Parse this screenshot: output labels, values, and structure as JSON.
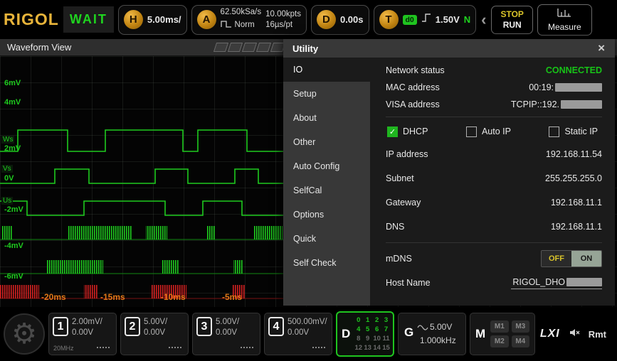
{
  "header": {
    "logo": "RIGOL",
    "run_state": "WAIT",
    "horizontal": {
      "knob": "H",
      "timebase": "5.00ms/"
    },
    "acquire": {
      "knob": "A",
      "sample_rate": "62.50kSa/s",
      "mode": "Norm",
      "mem_depth": "10.00kpts",
      "time_per_pt": "16µs/pt"
    },
    "delay": {
      "knob": "D",
      "value": "0.00s"
    },
    "trigger": {
      "knob": "T",
      "source": "d0",
      "level": "1.50V",
      "slope": "N"
    },
    "chevron_left": "‹",
    "stop_label": "STOP",
    "run_label": "RUN",
    "measure_label": "Measure"
  },
  "waveform_view": {
    "title": "Waveform View",
    "y_labels": [
      "6mV",
      "4mV",
      "2mV",
      "0V",
      "-2mV",
      "-4mV",
      "-6mV"
    ],
    "marker_labels": [
      "Ws",
      "Vs",
      "Us"
    ],
    "x_labels": [
      "-20ms",
      "-15ms",
      "-10ms",
      "-5ms"
    ]
  },
  "utility": {
    "title": "Utility",
    "close": "×",
    "menu": [
      "IO",
      "Setup",
      "About",
      "Other",
      "Auto Config",
      "SelfCal",
      "Options",
      "Quick",
      "Self Check"
    ],
    "io": {
      "network_status_label": "Network status",
      "network_status": "CONNECTED",
      "mac_label": "MAC address",
      "mac_visible": "00:19:",
      "visa_label": "VISA address",
      "visa_visible": "TCPIP::192.",
      "dhcp_label": "DHCP",
      "auto_ip_label": "Auto IP",
      "static_ip_label": "Static IP",
      "check_glyph": "✓",
      "ip_label": "IP address",
      "ip": "192.168.11.54",
      "subnet_label": "Subnet",
      "subnet": "255.255.255.0",
      "gateway_label": "Gateway",
      "gateway": "192.168.11.1",
      "dns_label": "DNS",
      "dns": "192.168.11.1",
      "mdns_label": "mDNS",
      "mdns_off": "OFF",
      "mdns_on": "ON",
      "hostname_label": "Host Name",
      "hostname_visible": "RIGOL_DHO"
    }
  },
  "footer": {
    "menu_gear": "⚙",
    "channels": [
      {
        "num": "1",
        "scale": "2.00mV/",
        "offset": "0.00V",
        "bandwidth": "20MHz"
      },
      {
        "num": "2",
        "scale": "5.00V/",
        "offset": "0.00V"
      },
      {
        "num": "3",
        "scale": "5.00V/",
        "offset": "0.00V"
      },
      {
        "num": "4",
        "scale": "500.00mV/",
        "offset": "0.00V"
      }
    ],
    "digital": {
      "label": "D",
      "bits": [
        "0",
        "1",
        "2",
        "3",
        "4",
        "5",
        "6",
        "7",
        "8",
        "9",
        "10",
        "11",
        "12",
        "13",
        "14",
        "15"
      ]
    },
    "generator": {
      "label": "G",
      "amplitude": "5.00V",
      "frequency": "1.000kHz"
    },
    "math": {
      "label": "M",
      "slots": [
        "M1",
        "M3",
        "M2",
        "M4"
      ]
    },
    "status_icons": {
      "lxi": "LXI",
      "remote": "Rmt"
    }
  },
  "colors": {
    "accent_green": "#1fc41f",
    "accent_gold": "#e8b43a",
    "trace_green": "#1ecb1e",
    "burst_red": "#d42020",
    "x_label_orange": "#e07818"
  }
}
